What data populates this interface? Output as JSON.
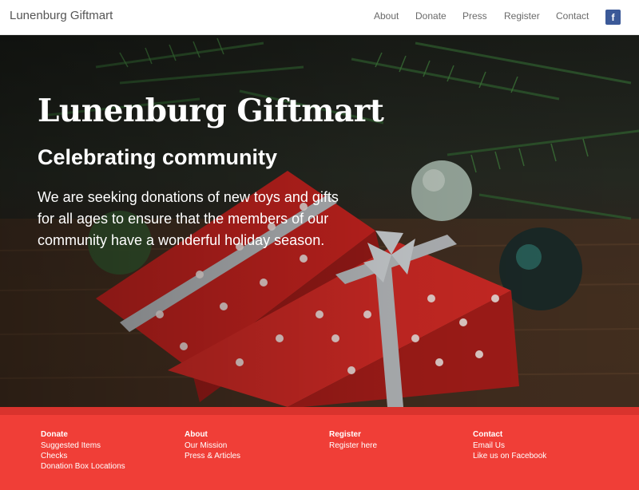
{
  "nav": {
    "brand": "Lunenburg Giftmart",
    "links": [
      "About",
      "Donate",
      "Press",
      "Register",
      "Contact"
    ],
    "social_icon": "facebook-icon",
    "social_glyph": "f"
  },
  "hero": {
    "title": "Lunenburg Giftmart",
    "subtitle": "Celebrating community",
    "body": "We are seeking donations of new toys and gifts for all ages to ensure that the members of our community have a wonderful holiday season."
  },
  "footer": {
    "columns": [
      {
        "heading": "Donate",
        "links": [
          "Suggested Items",
          "Checks",
          "Donation Box Locations"
        ]
      },
      {
        "heading": "About",
        "links": [
          "Our Mission",
          "Press & Articles"
        ]
      },
      {
        "heading": "Register",
        "links": [
          "Register here"
        ]
      },
      {
        "heading": "Contact",
        "links": [
          "Email Us",
          "Like us on Facebook"
        ]
      }
    ]
  },
  "colors": {
    "footer_bg": "#f03e37",
    "facebook_blue": "#3b5998",
    "gift_red": "#c8231f"
  }
}
